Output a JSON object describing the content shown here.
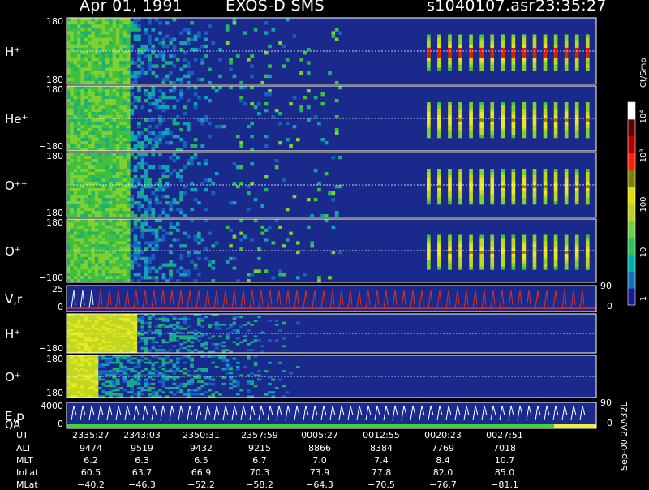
{
  "header": {
    "date": "Apr 01, 1991",
    "instrument": "EXOS-D SMS",
    "file": "s1040107.asr",
    "time": "23:35:27"
  },
  "colorbar": {
    "unit": "Ct/Smp",
    "tick_labels": [
      "10⁴",
      "10³",
      "100",
      "10",
      "1"
    ],
    "colors": [
      "#1a1a8e",
      "#1070c0",
      "#00b0b0",
      "#30c060",
      "#70d040",
      "#c0d020",
      "#e0e000",
      "#808000",
      "#ff2000",
      "#b00000",
      "#600000",
      "#ffffff"
    ]
  },
  "panels": [
    {
      "label": "H⁺",
      "ymax": "180",
      "ymin": "−180"
    },
    {
      "label": "He⁺",
      "ymax": "180",
      "ymin": "−180"
    },
    {
      "label": "O⁺⁺",
      "ymax": "180",
      "ymin": "−180"
    },
    {
      "label": "O⁺",
      "ymax": "180",
      "ymin": "−180"
    },
    {
      "label": "V,r",
      "ymax": "25",
      "ymin": "0",
      "right_top": "90",
      "right_bottom": "0"
    },
    {
      "label": "H⁺",
      "ymax": "",
      "ymin": "−180"
    },
    {
      "label": "O⁺",
      "ymax": "180",
      "ymin": "−180"
    },
    {
      "label": "E,p",
      "label2": "QA",
      "ymax": "4000",
      "ymin": "0",
      "right_top": "90",
      "right_bottom": "0"
    }
  ],
  "table": {
    "rows": [
      {
        "label": "UT",
        "values": [
          "2335:27",
          "2343:03",
          "2350:31",
          "2357:59",
          "0005:27",
          "0012:55",
          "0020:23",
          "0027:51"
        ]
      },
      {
        "label": "ALT",
        "values": [
          "9474",
          "9519",
          "9432",
          "9215",
          "8866",
          "8384",
          "7769",
          "7018"
        ]
      },
      {
        "label": "MLT",
        "values": [
          "6.2",
          "6.3",
          "6.5",
          "6.7",
          "7.0",
          "7.4",
          "8.4",
          "10.7"
        ]
      },
      {
        "label": "InLat",
        "values": [
          "60.5",
          "63.7",
          "66.9",
          "70.3",
          "73.9",
          "77.8",
          "82.0",
          "85.0"
        ]
      },
      {
        "label": "MLat",
        "values": [
          "−40.2",
          "−46.3",
          "−52.2",
          "−58.2",
          "−64.3",
          "−70.5",
          "−76.7",
          "−81.1"
        ]
      }
    ]
  },
  "source_id": "Sep-00 2AA32L",
  "chart_data": {
    "type": "heatmap",
    "x_label": "UT",
    "x_ticks": [
      "2335:27",
      "2343:03",
      "2350:31",
      "2357:59",
      "0005:27",
      "0012:55",
      "0020:23",
      "0027:51"
    ],
    "series": [
      {
        "name": "H⁺",
        "ylim": [
          -180,
          180
        ]
      },
      {
        "name": "He⁺",
        "ylim": [
          -180,
          180
        ]
      },
      {
        "name": "O⁺⁺",
        "ylim": [
          -180,
          180
        ]
      },
      {
        "name": "O⁺",
        "ylim": [
          -180,
          180
        ]
      },
      {
        "name": "V,r",
        "ylim": [
          0,
          25
        ]
      },
      {
        "name": "H⁺",
        "ylim": [
          -180,
          180
        ]
      },
      {
        "name": "O⁺",
        "ylim": [
          -180,
          180
        ]
      },
      {
        "name": "E,p / QA",
        "ylim": [
          0,
          4000
        ]
      }
    ],
    "colorscale": {
      "unit": "Ct/Smp",
      "ticks": [
        "1",
        "10",
        "100",
        "10³",
        "10⁴"
      ]
    }
  }
}
